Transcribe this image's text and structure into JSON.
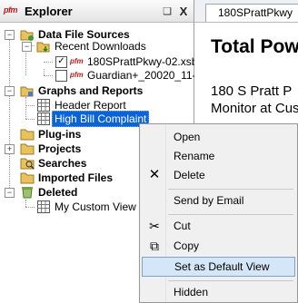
{
  "panel": {
    "logo": "pfm",
    "title": "Explorer",
    "pin_icon": "pin-icon",
    "close_icon": "close-icon",
    "close_glyph": "X",
    "pin_glyph": "❑"
  },
  "tree": {
    "data_file_sources": "Data File Sources",
    "recent_downloads": "Recent Downloads",
    "file1": "180SPrattPkwy-02.xsb",
    "file2": "Guardian+_20020_11-",
    "file_prefix": "pfm",
    "graphs_and_reports": "Graphs and Reports",
    "header_report": "Header Report",
    "high_bill_complaint": "High Bill Complaint",
    "plugins": "Plug-ins",
    "projects": "Projects",
    "searches": "Searches",
    "imported_files": "Imported Files",
    "deleted": "Deleted",
    "my_custom_view": "My Custom View",
    "expand_minus": "−",
    "expand_plus": "+",
    "check": "✓"
  },
  "document": {
    "tab": "180SPrattPkwy",
    "heading": "Total Pow",
    "line1": "180 S Pratt P",
    "line2": "Monitor at Cus"
  },
  "menu": {
    "items": [
      {
        "label": "Open"
      },
      {
        "label": "Rename"
      },
      {
        "label": "Delete",
        "icon": "✕"
      },
      {
        "label": "Send by Email"
      },
      {
        "label": "Cut",
        "icon": "✂"
      },
      {
        "label": "Copy",
        "icon": "⧉"
      },
      {
        "label": "Set as Default View"
      },
      {
        "label": "Hidden"
      }
    ]
  },
  "colors": {
    "selection": "#0a64d7",
    "menu_hover": "#d5e6f8",
    "brand_red": "#c01818"
  }
}
